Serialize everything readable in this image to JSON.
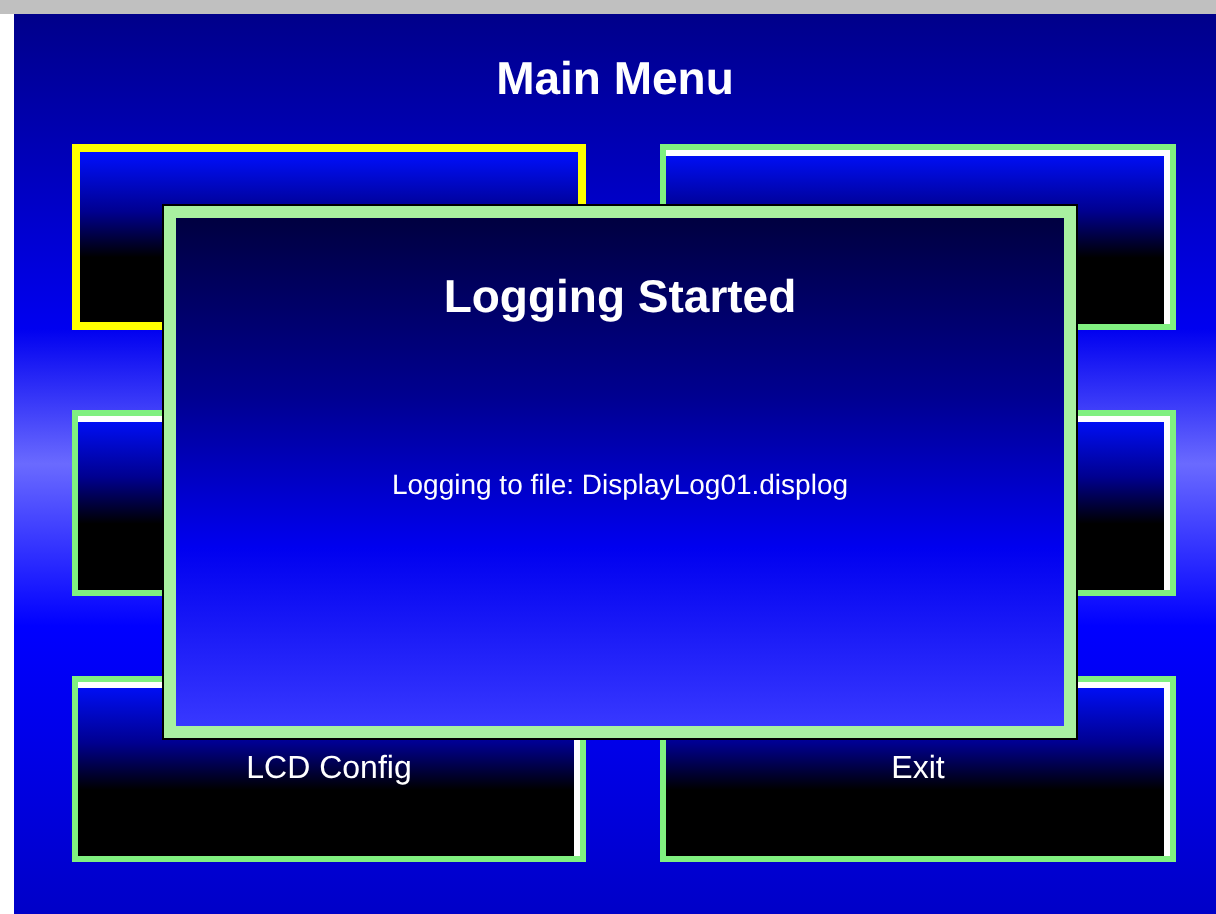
{
  "title": "Main Menu",
  "buttons": [
    {
      "selected": true
    },
    {
      "selected": false
    },
    {
      "selected": false
    },
    {
      "selected": false
    },
    {
      "label": "LCD Config",
      "selected": false
    },
    {
      "label": "Exit",
      "selected": false
    }
  ],
  "dialog": {
    "title": "Logging Started",
    "message": "Logging to file: DisplayLog01.displog"
  }
}
